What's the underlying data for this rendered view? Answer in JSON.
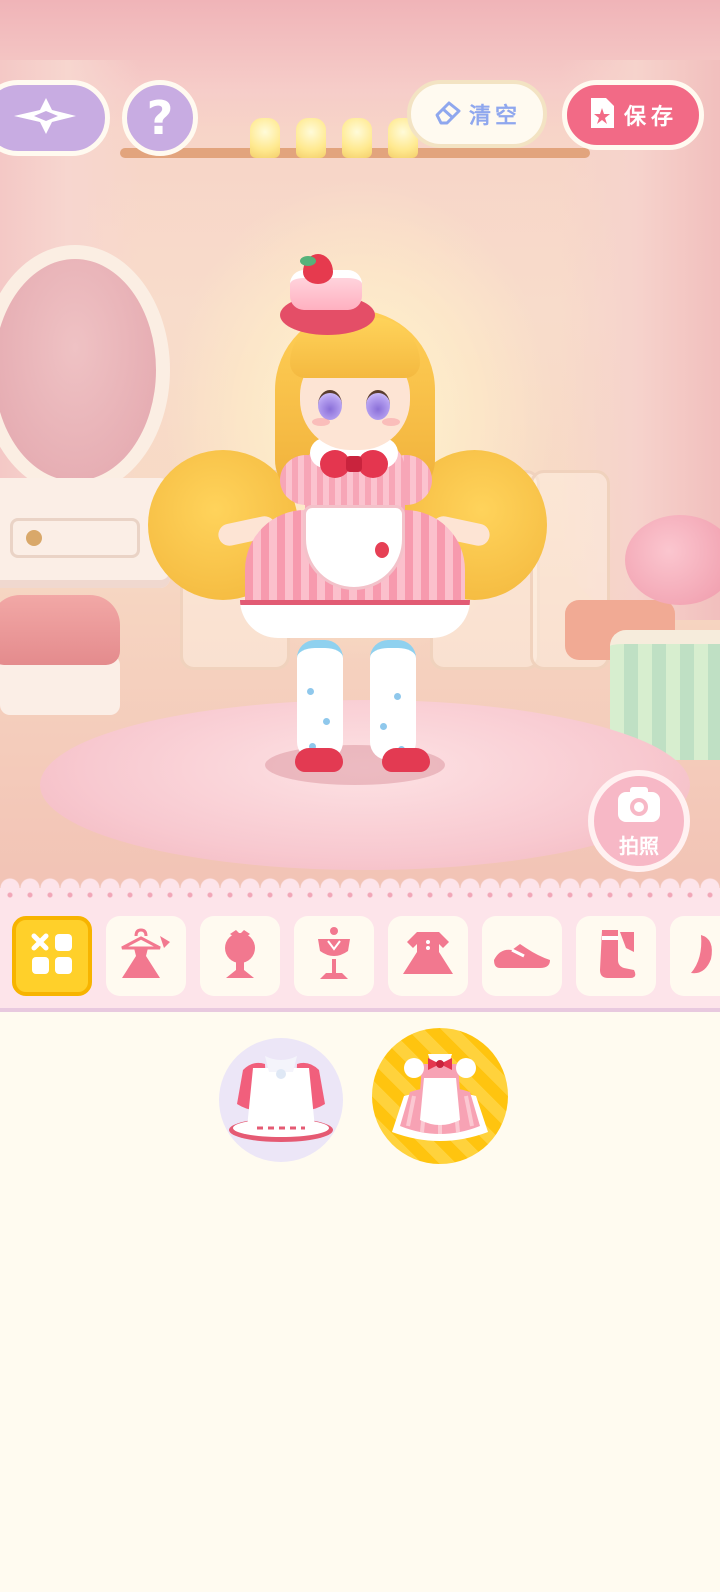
{
  "toolbar": {
    "back_icon": "compass-star-icon",
    "help_label": "?",
    "clear_label": "清空",
    "clear_icon": "eraser-icon",
    "save_label": "保存",
    "save_icon": "save-file-icon"
  },
  "photo_button": {
    "label": "拍照",
    "icon": "camera-icon"
  },
  "categories": [
    {
      "name": "all",
      "icon": "grid-four-icon",
      "active": true
    },
    {
      "name": "outfit-set",
      "icon": "dress-hanger-icon",
      "active": false
    },
    {
      "name": "headwear",
      "icon": "head-bow-icon",
      "active": false
    },
    {
      "name": "tops",
      "icon": "top-mannequin-icon",
      "active": false
    },
    {
      "name": "dress",
      "icon": "dress-icon",
      "active": false
    },
    {
      "name": "shoes",
      "icon": "shoe-icon",
      "active": false
    },
    {
      "name": "socks",
      "icon": "socks-icon",
      "active": false
    },
    {
      "name": "more",
      "icon": "partial-icon",
      "active": false
    }
  ],
  "items": [
    {
      "name": "white-apron-dress",
      "selected": false
    },
    {
      "name": "strawberry-maid-dress",
      "selected": true
    }
  ],
  "colors": {
    "accent_pink": "#f26a86",
    "lavender": "#c8ace2",
    "tab_active": "#ffd02a",
    "tab_icon": "#f2788f",
    "clear_text": "#8fa7ee"
  }
}
